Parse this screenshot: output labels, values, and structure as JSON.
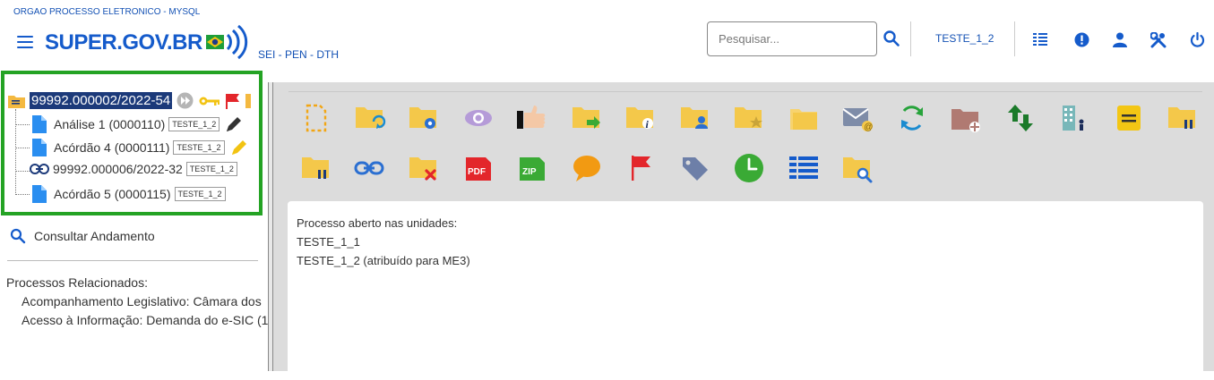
{
  "header": {
    "org_name": "ORGAO PROCESSO ELETRONICO - MYSQL",
    "logo_text": "SUPER.GOV.BR",
    "subtitle": "SEI - PEN - DTH",
    "search_placeholder": "Pesquisar...",
    "unit": "TESTE_1_2",
    "accent_color": "#155bcb"
  },
  "tree": {
    "main_process": "99992.000002/2022-54",
    "items": [
      {
        "label": "Análise 1 (0000110)",
        "tag": "TESTE_1_2"
      },
      {
        "label": "Acórdão 4 (0000111)",
        "tag": "TESTE_1_2"
      },
      {
        "label": "99992.000006/2022-32",
        "tag": "TESTE_1_2"
      },
      {
        "label": "Acórdão 5 (0000115)",
        "tag": "TESTE_1_2"
      }
    ]
  },
  "consult_label": "Consultar Andamento",
  "related": {
    "title": "Processos Relacionados:",
    "items": [
      "Acompanhamento Legislativo: Câmara dos",
      "Acesso à Informação: Demanda do e-SIC (1"
    ]
  },
  "toolbar_icons": [
    "new-document-icon",
    "send-process-icon",
    "process-settings-icon",
    "view-icon",
    "blind-sign-icon",
    "conclude-icon",
    "reopen-icon",
    "info-icon",
    "assign-user-icon",
    "favorite-icon",
    "folders-icon",
    "send-email-icon",
    "refresh-icon",
    "add-document-icon",
    "relationship-icon",
    "organization-icon",
    "note-icon",
    "suspend-icon",
    "link-icon",
    "cancel-process-icon",
    "pdf-icon",
    "zip-icon",
    "comment-icon",
    "flag-icon",
    "tag-icon",
    "clock-icon",
    "list-icon",
    "search-process-icon"
  ],
  "content": {
    "lines": [
      "Processo aberto nas unidades:",
      "TESTE_1_1",
      "TESTE_1_2 (atribuído para ME3)"
    ]
  }
}
